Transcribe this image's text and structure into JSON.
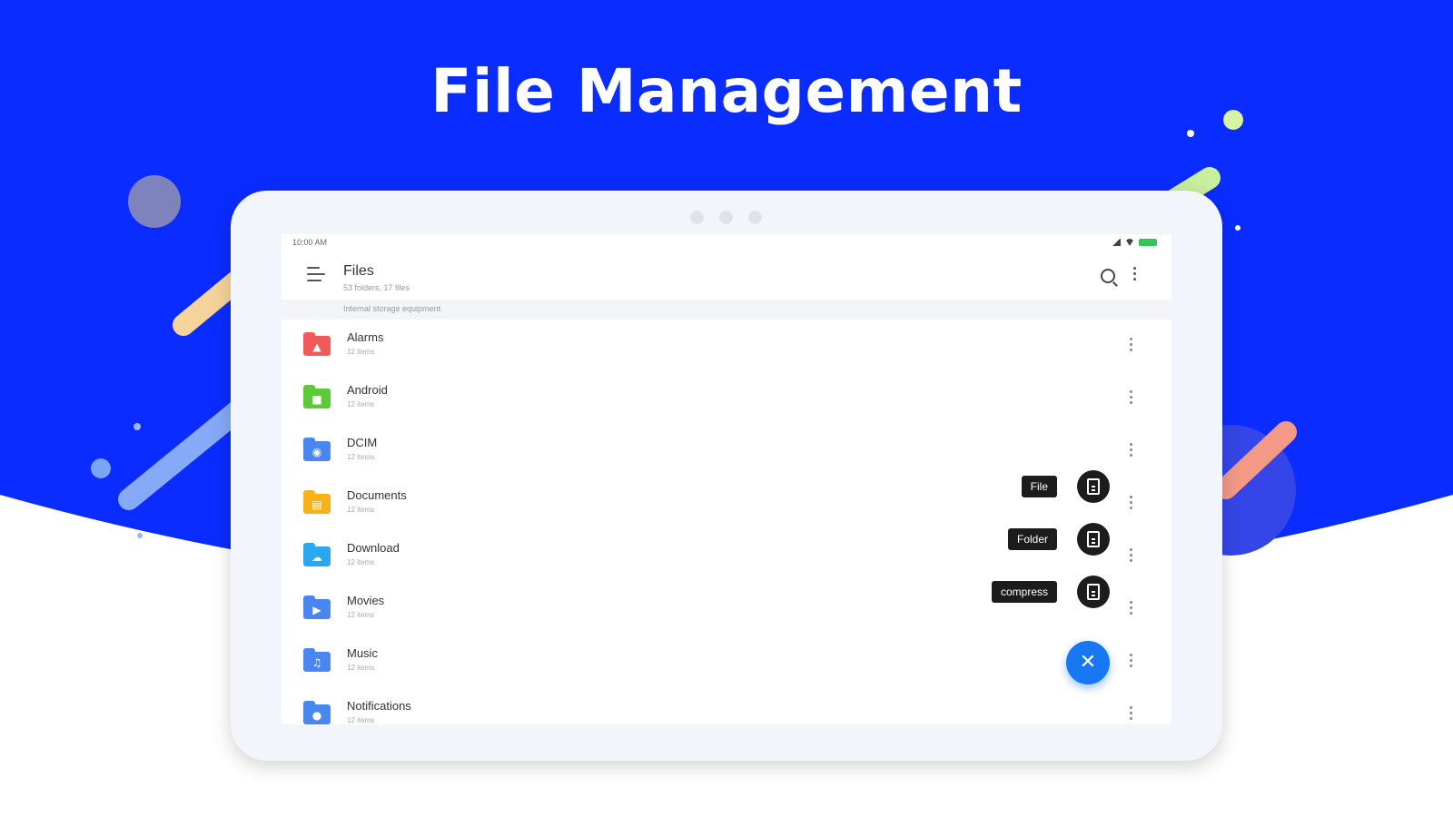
{
  "hero": {
    "title": "File Management"
  },
  "colors": {
    "brand_blue": "#0a2cff",
    "fab_blue": "#1877f2",
    "action_dark": "#1c1c1c"
  },
  "status_bar": {
    "time": "10:00 AM"
  },
  "app_bar": {
    "title": "Files",
    "subtitle": "53 folders, 17 files",
    "menu_icon": "hamburger-menu-icon",
    "search_icon": "search-icon",
    "more_icon": "more-vert-icon"
  },
  "path_bar": {
    "text": "Internal storage equipment"
  },
  "folders": [
    {
      "name": "Alarms",
      "meta": "12 items",
      "color": "#f25a5a",
      "glyph": "▲",
      "icon": "alarm-folder-icon"
    },
    {
      "name": "Android",
      "meta": "12 items",
      "color": "#5cc936",
      "glyph": "■",
      "icon": "android-folder-icon"
    },
    {
      "name": "DCIM",
      "meta": "12 items",
      "color": "#4a86f0",
      "glyph": "◉",
      "icon": "camera-folder-icon"
    },
    {
      "name": "Documents",
      "meta": "12 items",
      "color": "#f7b21b",
      "glyph": "▤",
      "icon": "document-folder-icon"
    },
    {
      "name": "Download",
      "meta": "12 items",
      "color": "#2aa7ee",
      "glyph": "☁",
      "icon": "download-folder-icon"
    },
    {
      "name": "Movies",
      "meta": "12 items",
      "color": "#4a86f0",
      "glyph": "▶",
      "icon": "movie-folder-icon"
    },
    {
      "name": "Music",
      "meta": "12 items",
      "color": "#4a86f0",
      "glyph": "♫",
      "icon": "music-folder-icon"
    },
    {
      "name": "Notifications",
      "meta": "12 items",
      "color": "#4a86f0",
      "glyph": "●",
      "icon": "notification-folder-icon"
    }
  ],
  "fab_menu": {
    "actions": [
      {
        "label": "File",
        "icon": "new-file-icon"
      },
      {
        "label": "Folder",
        "icon": "new-folder-icon"
      },
      {
        "label": "compress",
        "icon": "compress-icon"
      }
    ],
    "close_glyph": "✕",
    "close_icon": "close-icon"
  }
}
